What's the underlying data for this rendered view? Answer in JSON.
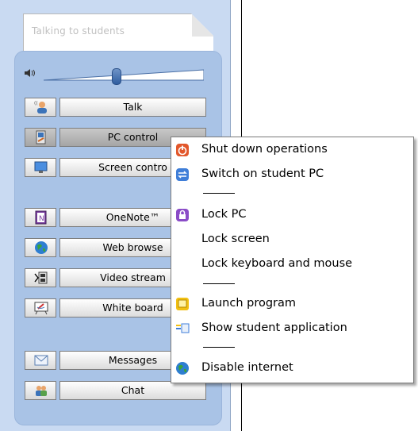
{
  "panel_title": "Talking to students",
  "volume": {
    "level_fraction": 0.45
  },
  "tools": [
    {
      "label": "Talk",
      "icon": "talk-icon"
    },
    {
      "label": "PC control",
      "icon": "pc-control-icon"
    },
    {
      "label": "Screen contro",
      "icon": "screen-control-icon"
    },
    {
      "label": "OneNote™",
      "icon": "onenote-icon"
    },
    {
      "label": "Web browse",
      "icon": "web-browser-icon"
    },
    {
      "label": "Video stream",
      "icon": "video-stream-icon"
    },
    {
      "label": "White board",
      "icon": "white-board-icon"
    },
    {
      "label": "Messages",
      "icon": "envelope-icon"
    },
    {
      "label": "Chat",
      "icon": "chat-icon"
    }
  ],
  "context_menu": {
    "items": [
      {
        "label": "Shut down operations",
        "icon": "power-icon"
      },
      {
        "label": "Switch on student PC",
        "icon": "switch-on-icon"
      },
      {
        "label": "Lock PC",
        "icon": "lock-icon"
      },
      {
        "label": "Lock screen",
        "icon": ""
      },
      {
        "label": "Lock keyboard and mouse",
        "icon": ""
      },
      {
        "label": "Launch program",
        "icon": "launch-program-icon"
      },
      {
        "label": "Show student application",
        "icon": "show-application-icon"
      },
      {
        "label": "Disable internet",
        "icon": "globe-icon"
      }
    ]
  },
  "colors": {
    "sidebar_bg": "#c9daf2",
    "panel_bg": "#a9c3e6",
    "menu_border": "#7b7b7b"
  }
}
